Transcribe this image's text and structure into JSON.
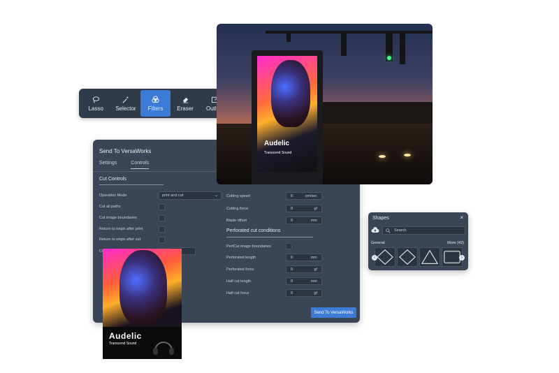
{
  "toolbar": {
    "tools": [
      {
        "label": "Lasso",
        "icon": "lasso-icon"
      },
      {
        "label": "Selector",
        "icon": "magic-wand-icon"
      },
      {
        "label": "Filters",
        "icon": "filters-icon",
        "active": true
      },
      {
        "label": "Eraser",
        "icon": "eraser-icon"
      },
      {
        "label": "Outline",
        "icon": "outline-icon"
      }
    ]
  },
  "dialog": {
    "title": "Send To VersaWorks",
    "tabs": [
      "Settings",
      "Controls"
    ],
    "active_tab": "Controls",
    "cut_controls": {
      "title": "Cut Controls",
      "operation_mode_label": "Operation Mode",
      "operation_mode_value": "print and cut",
      "checkbox_rows": [
        "Cut all paths",
        "Cut image boundaries",
        "Return to origin after print",
        "Return to origin after cut"
      ],
      "truncated_row_label": "Cu"
    },
    "speed_fields": [
      {
        "label": "Cutting speed",
        "value": "0",
        "unit": "cm/sec"
      },
      {
        "label": "Cutting force",
        "value": "0",
        "unit": "gf"
      },
      {
        "label": "Blade offset",
        "value": "0",
        "unit": "mm"
      }
    ],
    "perforated": {
      "title": "Perforated cut conditions",
      "checkbox_label": "PerfCut image boundaries",
      "fields": [
        {
          "label": "Perforated length",
          "value": "0",
          "unit": "mm"
        },
        {
          "label": "Perforated force",
          "value": "0",
          "unit": "gf"
        },
        {
          "label": "Half cut length",
          "value": "0",
          "unit": "mm"
        },
        {
          "label": "Half cut force",
          "value": "0",
          "unit": "gf"
        }
      ]
    },
    "send_button": "Send To VersaWorks"
  },
  "photo": {
    "ad_brand": "Audelic",
    "ad_tagline": "Transcend Sound"
  },
  "shapes_panel": {
    "title": "Shapes",
    "close": "×",
    "search_placeholder": "Search",
    "category": "General",
    "more": "More (42)",
    "shapes": [
      "diamond",
      "diamond",
      "triangle",
      "rectangle"
    ]
  },
  "poster": {
    "brand": "Audelic",
    "tagline": "Transcend Sound"
  },
  "colors": {
    "panel_bg": "#3a4655",
    "accent": "#3c7bd6",
    "field_bg": "#2b3440"
  }
}
